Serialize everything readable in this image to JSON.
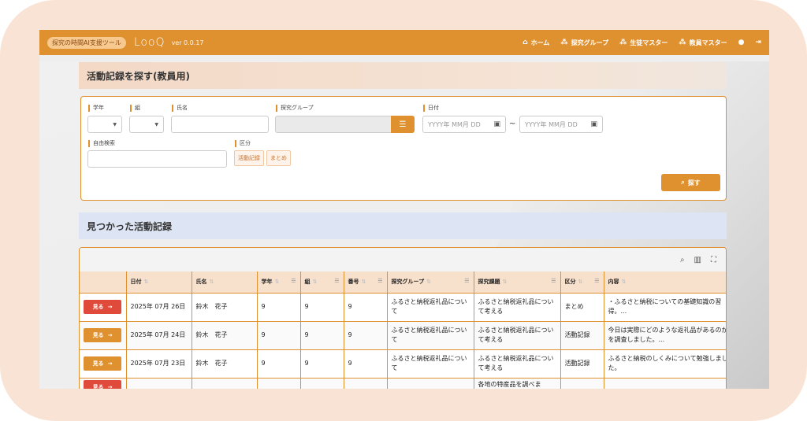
{
  "header": {
    "tag": "探究の時間AI支援ツール",
    "logo": "LooQ",
    "version": "ver 0.0.17",
    "nav": [
      {
        "icon": "home-icon",
        "label": "ホーム"
      },
      {
        "icon": "group-icon",
        "label": "探究グループ"
      },
      {
        "icon": "students-icon",
        "label": "生徒マスター"
      },
      {
        "icon": "teachers-icon",
        "label": "教員マスター"
      }
    ],
    "color": "#e0912f"
  },
  "search": {
    "title": "活動記録を探す(教員用)",
    "labels": {
      "grade": "学年",
      "class": "組",
      "name": "氏名",
      "group": "探究グループ",
      "date": "日付",
      "freetext": "自由検索",
      "category": "区分"
    },
    "date_from_placeholder": "YYYY年 MM月 DD",
    "date_to_placeholder": "YYYY年 MM月 DD",
    "tilde": "~",
    "chips": [
      "活動記録",
      "まとめ"
    ],
    "button": "探す"
  },
  "results": {
    "title": "見つかった活動記録",
    "columns": [
      "",
      "日付",
      "氏名",
      "学年",
      "組",
      "番号",
      "探究グループ",
      "探究課題",
      "区分",
      "内容"
    ],
    "view_label": "見る",
    "rows": [
      {
        "button_color": "red",
        "date": "2025年 07月 26日",
        "name": "鈴木　花子",
        "grade": "9",
        "class": "9",
        "number": "9",
        "group": "ふるさと納税返礼品について",
        "topic": "ふるさと納税返礼品について考える",
        "category": "まとめ",
        "content": "・ふるさと納税についての基礎知識の習得。..."
      },
      {
        "button_color": "orange",
        "date": "2025年 07月 24日",
        "name": "鈴木　花子",
        "grade": "9",
        "class": "9",
        "number": "9",
        "group": "ふるさと納税返礼品について",
        "topic": "ふるさと納税返礼品について考える",
        "category": "活動記録",
        "content": "今日は実際にどのような返礼品があるのかを調査しました。..."
      },
      {
        "button_color": "orange",
        "date": "2025年 07月 23日",
        "name": "鈴木　花子",
        "grade": "9",
        "class": "9",
        "number": "9",
        "group": "ふるさと納税返礼品について",
        "topic": "ふるさと納税返礼品について考える",
        "category": "活動記録",
        "content": "ふるさと納税のしくみについて勉強しました。"
      },
      {
        "button_color": "red",
        "date": "",
        "name": "",
        "grade": "",
        "class": "",
        "number": "",
        "group": "",
        "topic": "各地の特産品を調べま",
        "category": "",
        "content": ""
      }
    ]
  }
}
